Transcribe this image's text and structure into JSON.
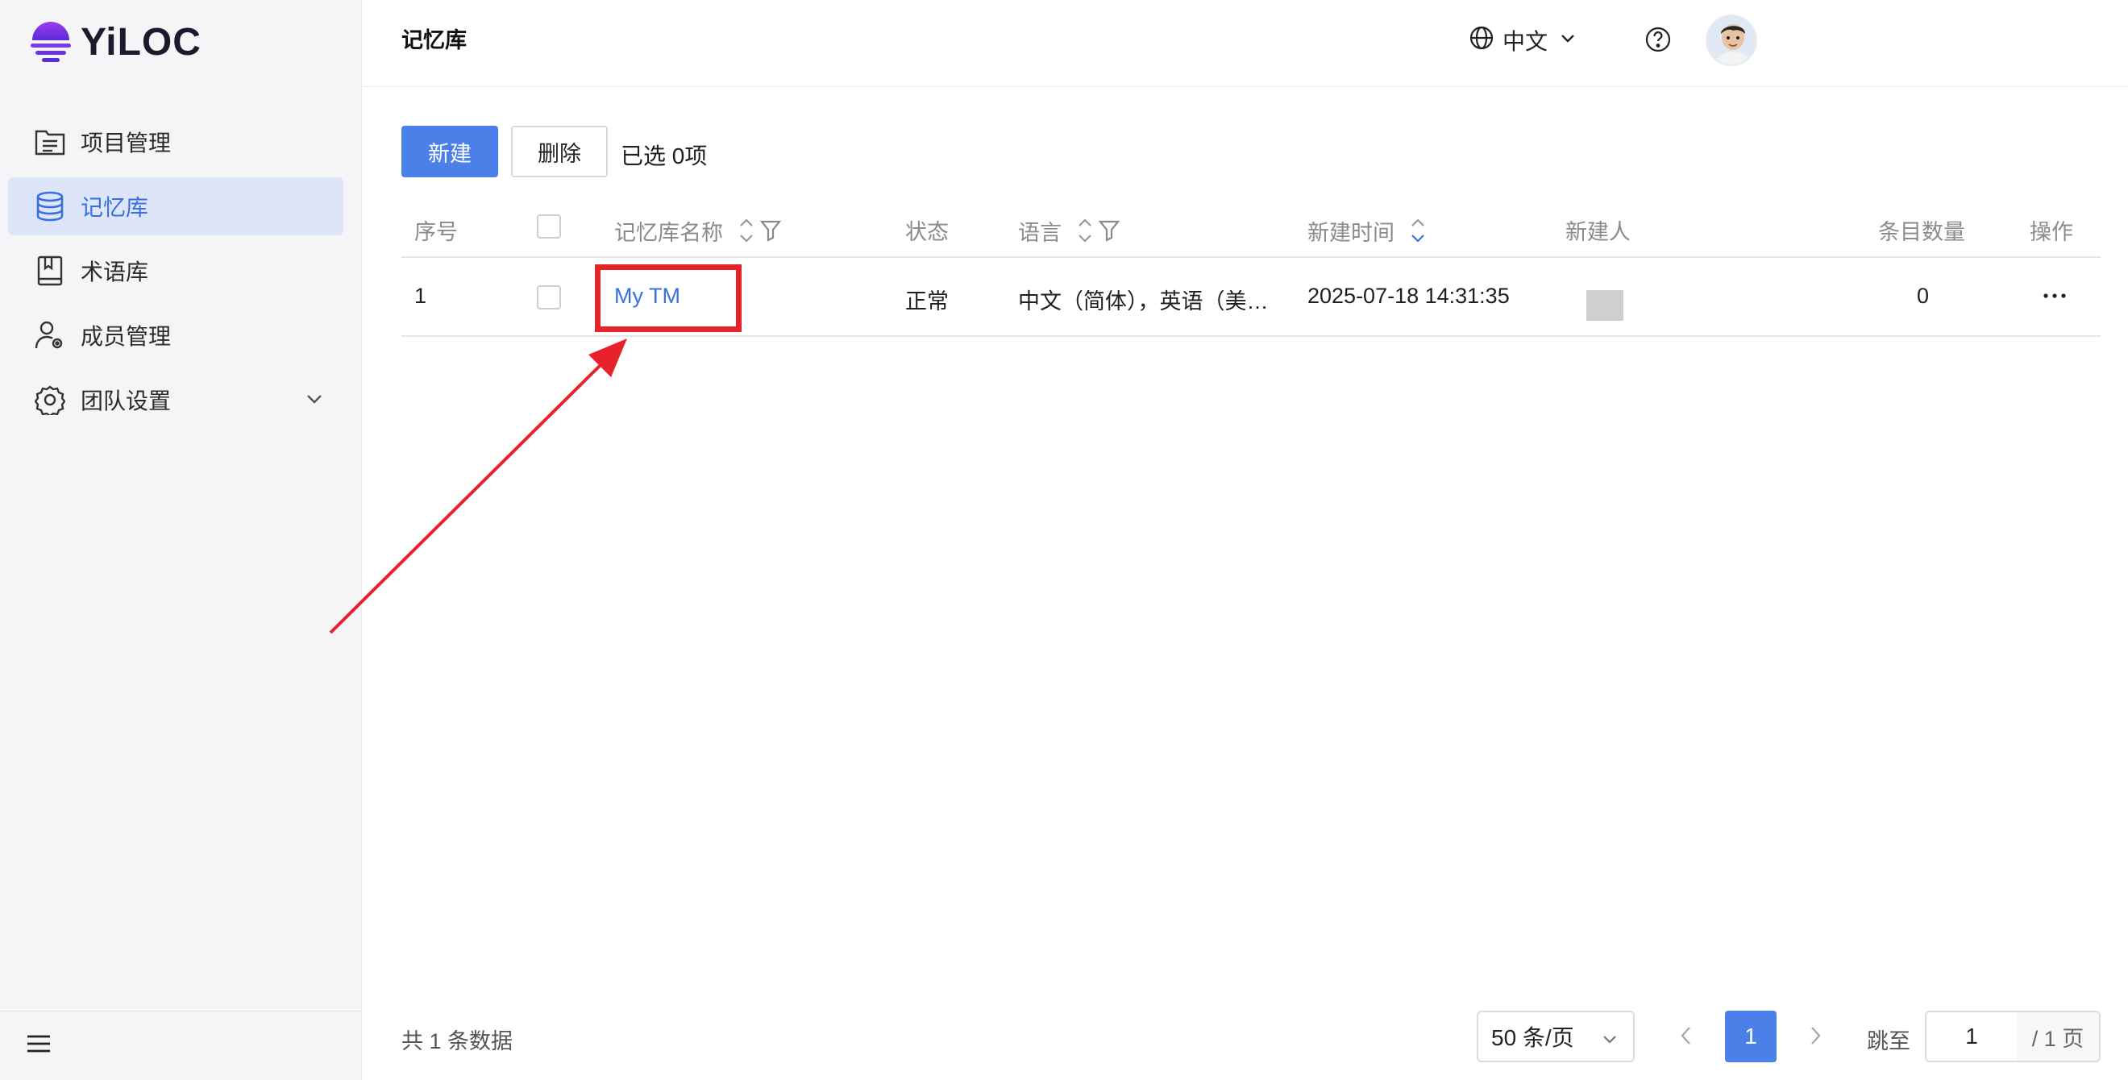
{
  "brand": {
    "name": "YiLOC"
  },
  "sidebar": {
    "items": [
      {
        "label": "项目管理",
        "icon": "folder-list-icon"
      },
      {
        "label": "记忆库",
        "icon": "database-icon",
        "active": true
      },
      {
        "label": "术语库",
        "icon": "book-icon"
      },
      {
        "label": "成员管理",
        "icon": "user-gear-icon"
      },
      {
        "label": "团队设置",
        "icon": "gear-icon"
      }
    ]
  },
  "header": {
    "title": "记忆库",
    "language": "中文"
  },
  "toolbar": {
    "new_label": "新建",
    "delete_label": "删除",
    "selected_text": "已选 0项"
  },
  "table": {
    "columns": {
      "index": "序号",
      "name": "记忆库名称",
      "status": "状态",
      "language": "语言",
      "created_at": "新建时间",
      "creator": "新建人",
      "entries": "条目数量",
      "actions": "操作"
    },
    "rows": [
      {
        "index": "1",
        "name": "My TM",
        "status": "正常",
        "language": "中文（简体），英语（美…",
        "created_at": "2025-07-18 14:31:35",
        "creator": "",
        "entries": "0"
      }
    ]
  },
  "pagination": {
    "total_text": "共 1 条数据",
    "page_size": "50 条/页",
    "current_page": "1",
    "jump_label": "跳至",
    "jump_value": "1",
    "total_pages": "/ 1 页"
  },
  "colors": {
    "primary": "#4a80e8",
    "active_bg": "#dde6f8",
    "annotation_red": "#e8222a",
    "brand_purple": "#7c3aed"
  }
}
